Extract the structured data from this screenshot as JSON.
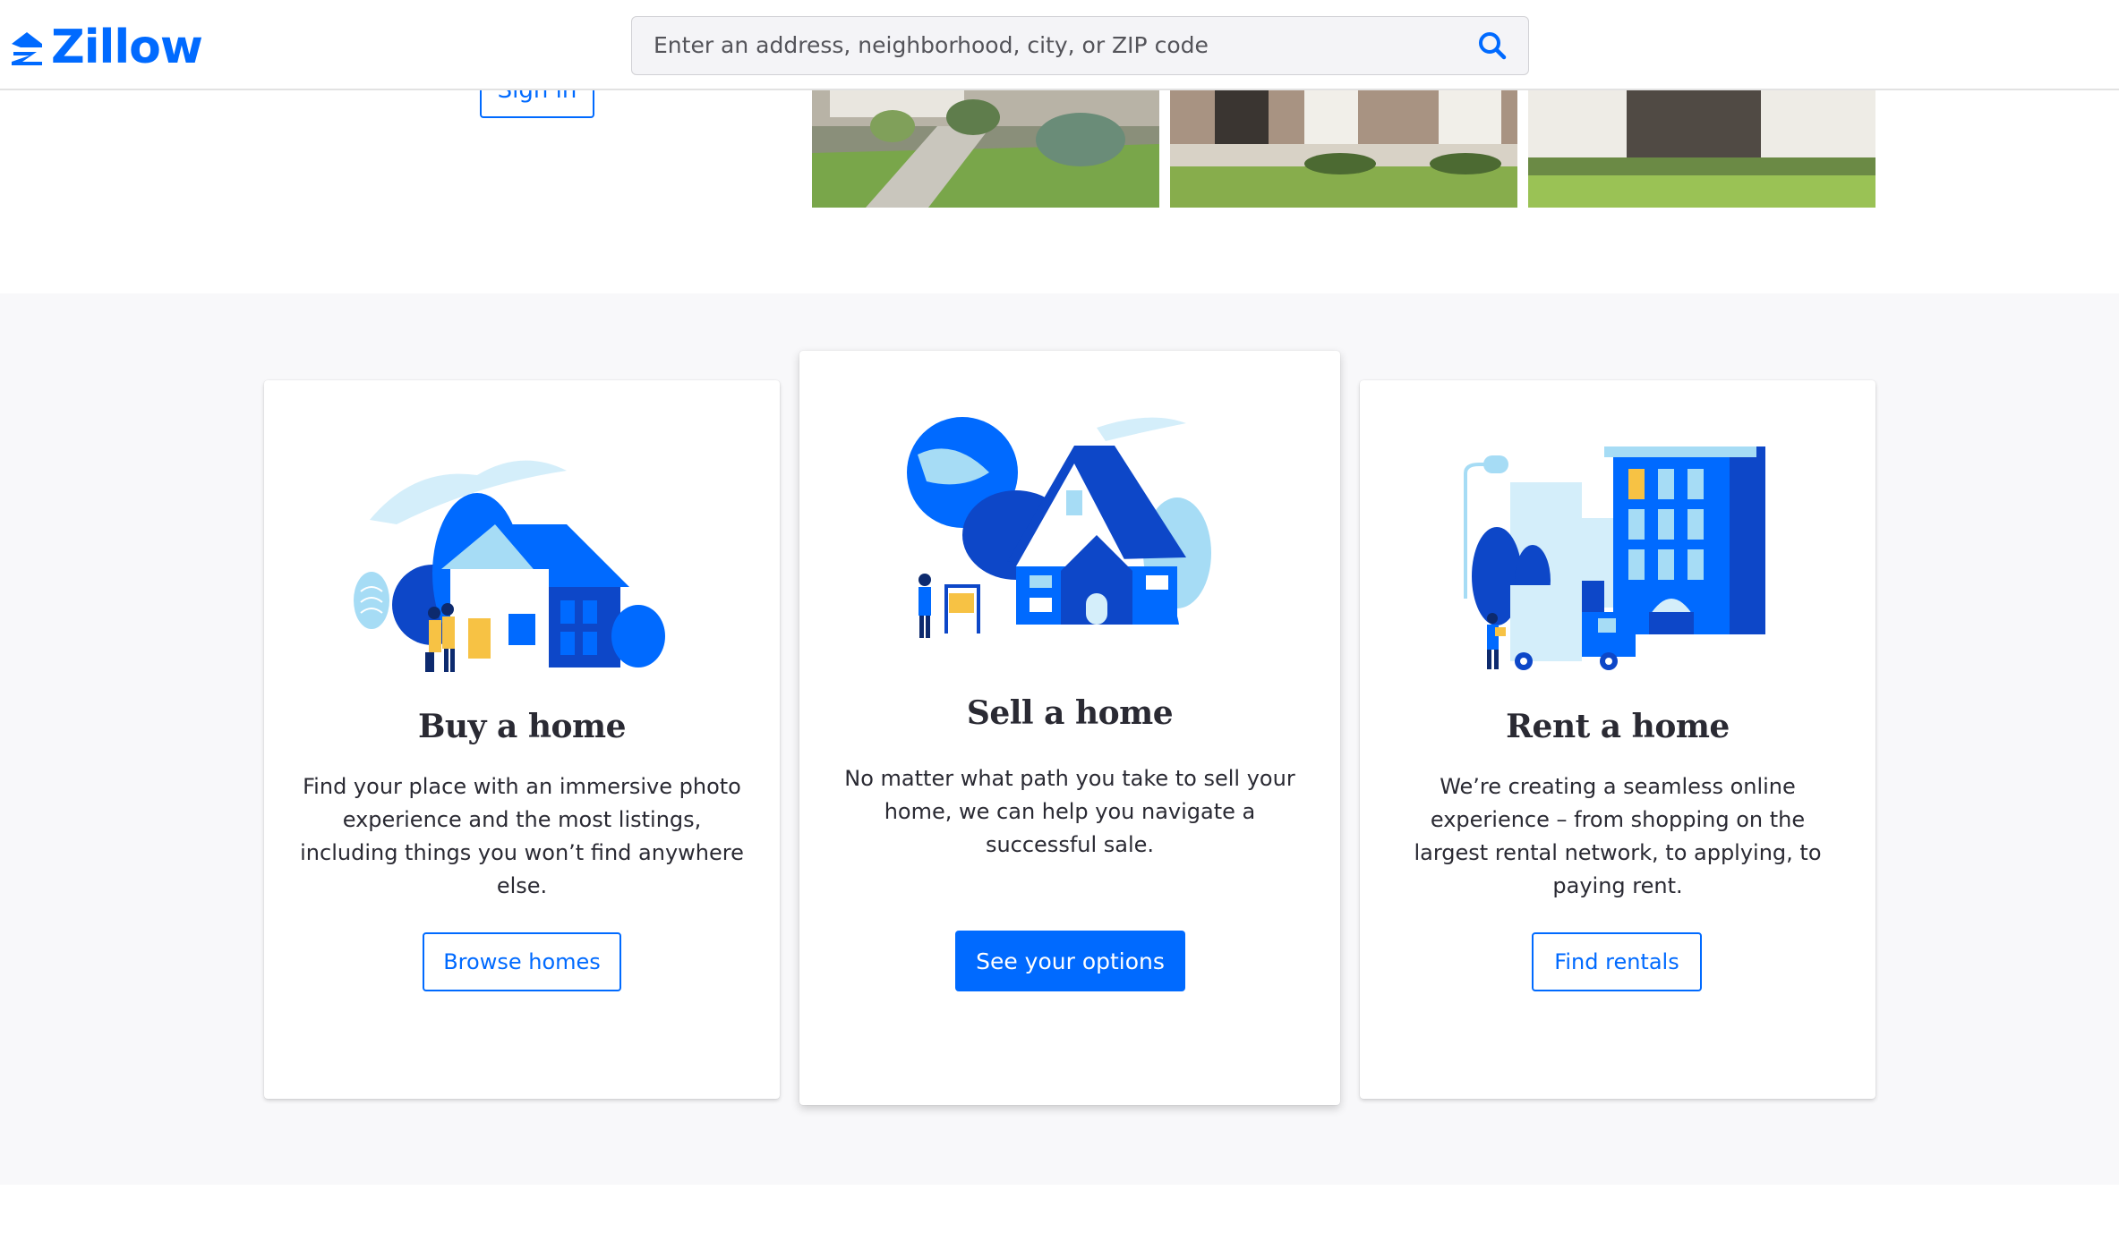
{
  "header": {
    "logo_text": "Zillow",
    "search_placeholder": "Enter an address, neighborhood, city, or ZIP code"
  },
  "hero": {
    "sign_in_label": "Sign in"
  },
  "cards": [
    {
      "title": "Buy a home",
      "text": "Find your place with an immersive photo experience and the most listings, including things you won’t find anywhere else.",
      "button": "Browse homes"
    },
    {
      "title": "Sell a home",
      "text": "No matter what path you take to sell your home, we can help you navigate a successful sale.",
      "button": "See your options"
    },
    {
      "title": "Rent a home",
      "text": "We’re creating a seamless online experience – from shopping on the largest rental network, to applying, to paying rent.",
      "button": "Find rentals"
    }
  ],
  "colors": {
    "brand_blue": "#006aff",
    "dark_blue": "#0d47c8",
    "light_blue": "#a6dcf5",
    "accent_yellow": "#f7c244",
    "section_gray": "#f8f8fa"
  },
  "icons": [
    "zillow-logo-icon",
    "search-icon"
  ]
}
